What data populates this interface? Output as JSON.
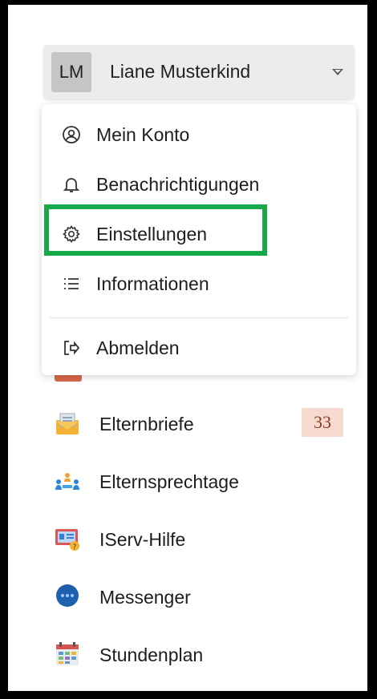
{
  "user": {
    "initials": "LM",
    "name": "Liane Musterkind"
  },
  "dropdown": {
    "items": [
      {
        "label": "Mein Konto",
        "icon": "user-circle-icon"
      },
      {
        "label": "Benachrichtigungen",
        "icon": "bell-icon"
      },
      {
        "label": "Einstellungen",
        "icon": "gear-icon"
      },
      {
        "label": "Informationen",
        "icon": "list-icon"
      }
    ],
    "logout": {
      "label": "Abmelden",
      "icon": "logout-icon"
    }
  },
  "nav": {
    "items": [
      {
        "label": "Elternbriefe",
        "icon": "envelope-letter-icon",
        "badge": "33"
      },
      {
        "label": "Elternsprechtage",
        "icon": "people-meeting-icon"
      },
      {
        "label": "IServ-Hilfe",
        "icon": "help-screen-icon"
      },
      {
        "label": "Messenger",
        "icon": "chat-bubble-icon"
      },
      {
        "label": "Stundenplan",
        "icon": "calendar-icon"
      }
    ]
  },
  "colors": {
    "highlight": "#17a84a",
    "badge_bg": "#f6d9cf",
    "badge_text": "#8a3a22"
  }
}
